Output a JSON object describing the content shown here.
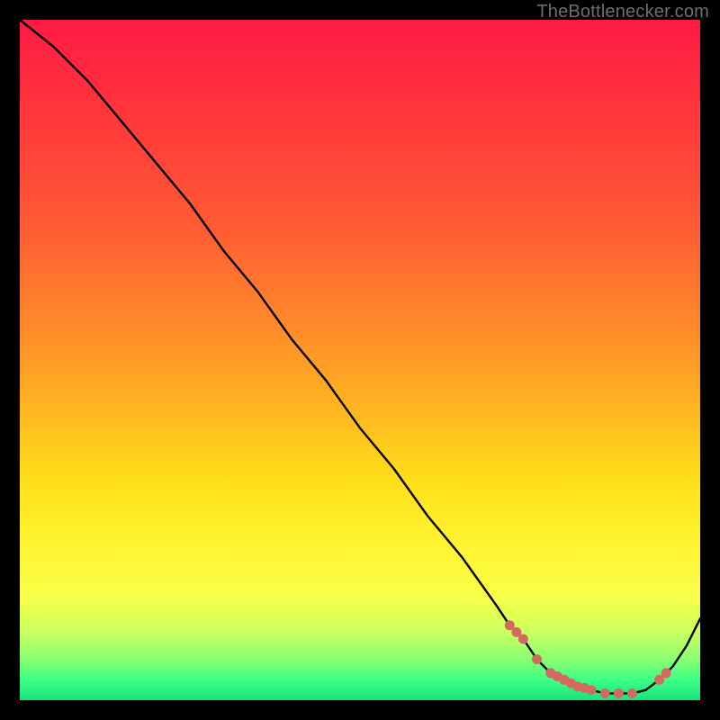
{
  "attribution": "TheBottlenecker.com",
  "colors": {
    "frame": "#000000",
    "line": "#000000",
    "marker": "#d46a5f",
    "gradient_top": "#ff1a44",
    "gradient_bottom": "#19e37a"
  },
  "chart_data": {
    "type": "line",
    "title": "",
    "xlabel": "",
    "ylabel": "",
    "xlim": [
      0,
      100
    ],
    "ylim": [
      0,
      100
    ],
    "x": [
      0,
      5,
      10,
      15,
      20,
      25,
      30,
      35,
      40,
      45,
      50,
      55,
      60,
      65,
      70,
      72,
      74,
      76,
      78,
      80,
      82,
      84,
      86,
      88,
      90,
      92,
      94,
      96,
      98,
      100
    ],
    "y": [
      100,
      96,
      91,
      85,
      79,
      73,
      66,
      60,
      53,
      47,
      40,
      34,
      27,
      21,
      14,
      11,
      9,
      6,
      4,
      3,
      2,
      1.5,
      1,
      1,
      1,
      1.5,
      3,
      5,
      8,
      12
    ],
    "markers": {
      "x": [
        72,
        73,
        74,
        76,
        78,
        79,
        80,
        81,
        82,
        83,
        84,
        86,
        88,
        90,
        94,
        95
      ],
      "y": [
        11,
        10,
        9,
        6,
        4,
        3.5,
        3,
        2.5,
        2,
        1.8,
        1.5,
        1,
        1,
        1,
        3,
        4
      ]
    }
  }
}
